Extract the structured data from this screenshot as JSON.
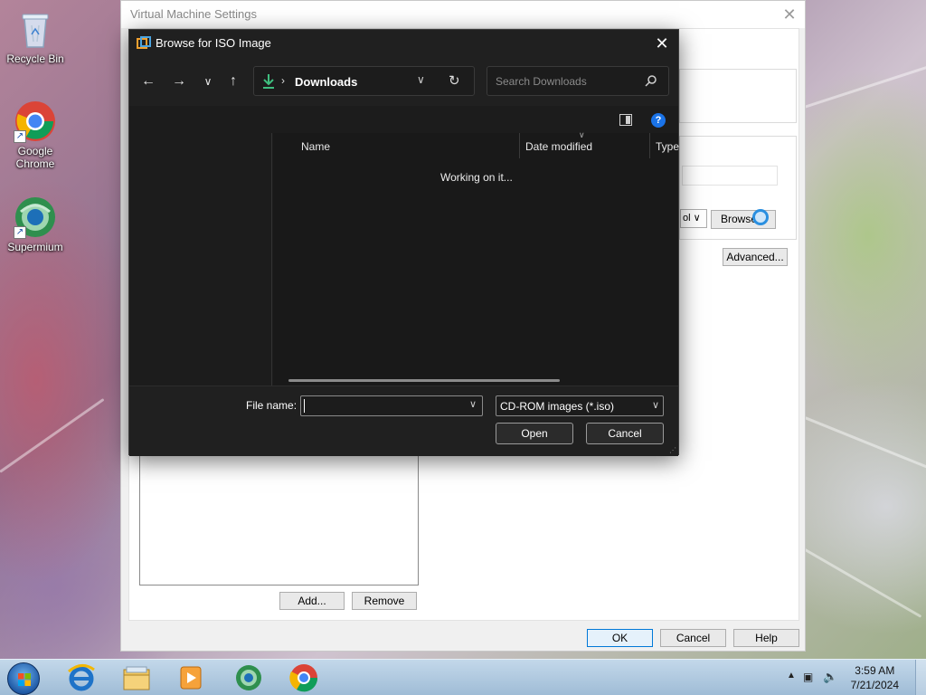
{
  "desktop": {
    "icons": [
      {
        "label": "Recycle Bin",
        "icon": "recycle-bin-icon"
      },
      {
        "label": "Google Chrome",
        "icon": "chrome-icon"
      },
      {
        "label": "Supermium",
        "icon": "supermium-icon"
      }
    ]
  },
  "vm_window": {
    "title": "Virtual Machine Settings",
    "browse_label": "Browse...",
    "advanced_label": "Advanced...",
    "add_label": "Add...",
    "remove_label": "Remove",
    "ok_label": "OK",
    "cancel_label": "Cancel",
    "help_label": "Help"
  },
  "dialog": {
    "title": "Browse for ISO Image",
    "address": {
      "location": "Downloads"
    },
    "search": {
      "placeholder": "Search Downloads"
    },
    "columns": [
      "Name",
      "Date modified",
      "Type"
    ],
    "status": "Working on it...",
    "file_name_label": "File name:",
    "file_name_value": "",
    "file_type_filter": "CD-ROM images (*.iso)",
    "open_label": "Open",
    "cancel_label": "Cancel"
  },
  "taskbar": {
    "apps": [
      "internet-explorer-icon",
      "file-explorer-icon",
      "media-player-icon",
      "supermium-icon",
      "chrome-icon"
    ],
    "clock": {
      "time": "3:59 AM",
      "date": "7/21/2024"
    }
  }
}
